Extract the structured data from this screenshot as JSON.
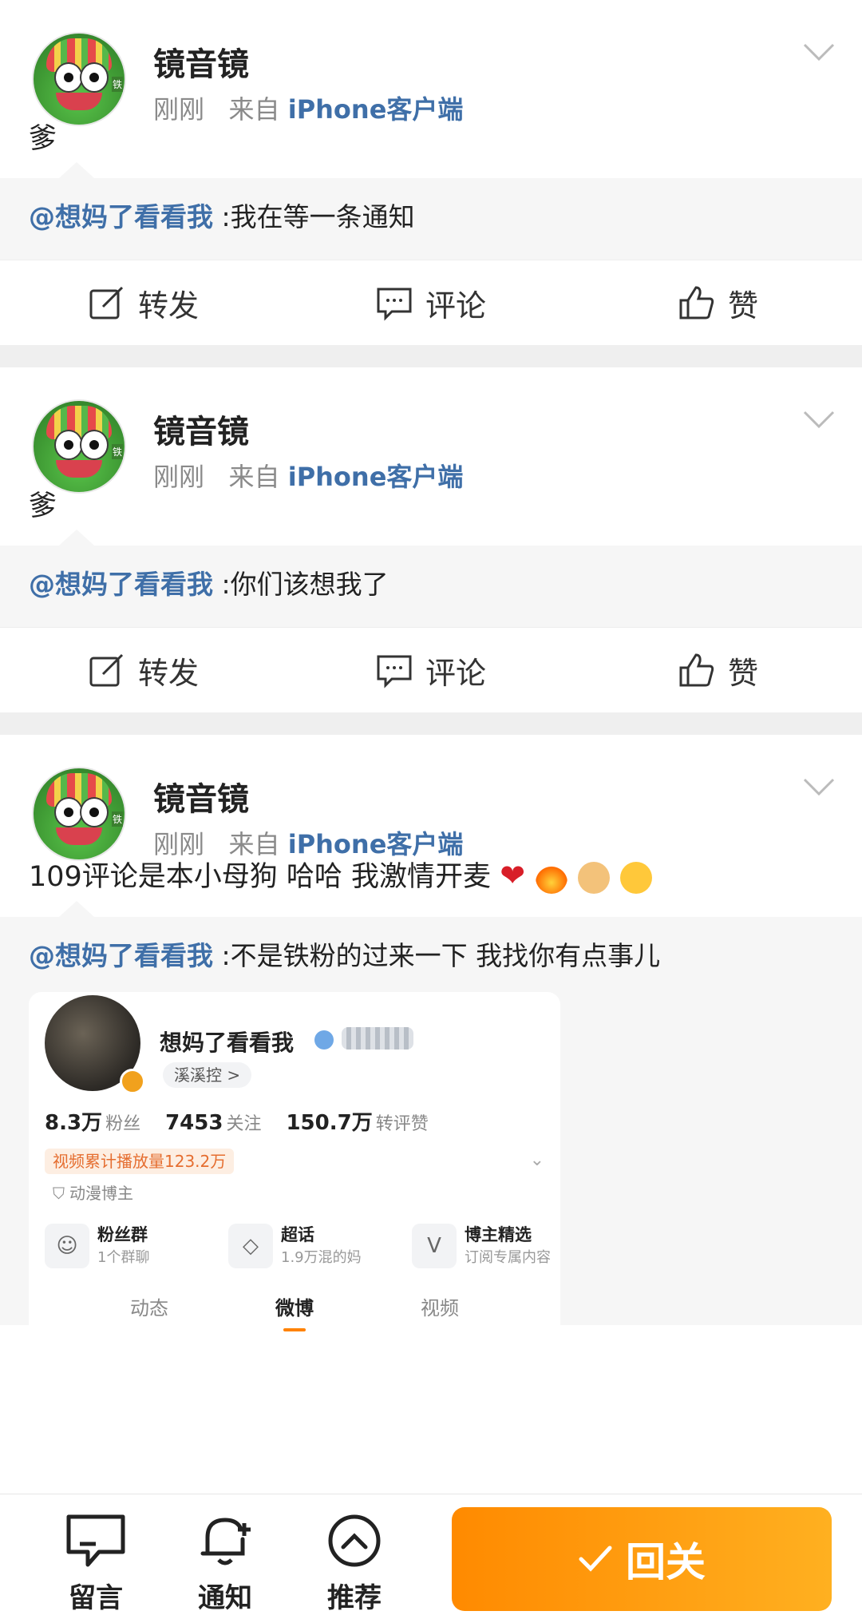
{
  "posts": [
    {
      "author": "镜音镜",
      "time": "刚刚",
      "from_prefix": "来自",
      "from_source": "iPhone客户端",
      "content": "爹",
      "quote_user": "@想妈了看看我",
      "quote_text": ":我在等一条通知"
    },
    {
      "author": "镜音镜",
      "time": "刚刚",
      "from_prefix": "来自",
      "from_source": "iPhone客户端",
      "content": "爹",
      "quote_user": "@想妈了看看我",
      "quote_text": ":你们该想我了"
    },
    {
      "author": "镜音镜",
      "time": "刚刚",
      "from_prefix": "来自",
      "from_source": "iPhone客户端",
      "content": "109评论是本小母狗 哈哈 我激情开麦",
      "quote_user": "@想妈了看看我",
      "quote_text": ":不是铁粉的过来一下 我找你有点事儿"
    }
  ],
  "actions": {
    "repost": "转发",
    "comment": "评论",
    "like": "赞"
  },
  "embedded_profile": {
    "name": "想妈了看看我",
    "super_tag": "溪溪控 >",
    "fans_value": "8.3万",
    "fans_label": "粉丝",
    "follow_value": "7453",
    "follow_label": "关注",
    "interact_value": "150.7万",
    "interact_label": "转评赞",
    "video_tag": "视频累计播放量123.2万",
    "category": "动漫博主",
    "grid": [
      {
        "title": "粉丝群",
        "sub": "1个群聊"
      },
      {
        "title": "超话",
        "sub": "1.9万混的妈"
      },
      {
        "title": "博主精选",
        "sub": "订阅专属内容"
      }
    ],
    "tabs": [
      "动态",
      "微博",
      "视频"
    ]
  },
  "bottom_bar": {
    "message": "留言",
    "notify": "通知",
    "recommend": "推荐",
    "follow_back": "回关"
  },
  "colors": {
    "link": "#3f6fa8",
    "accent": "#ff8a00"
  }
}
